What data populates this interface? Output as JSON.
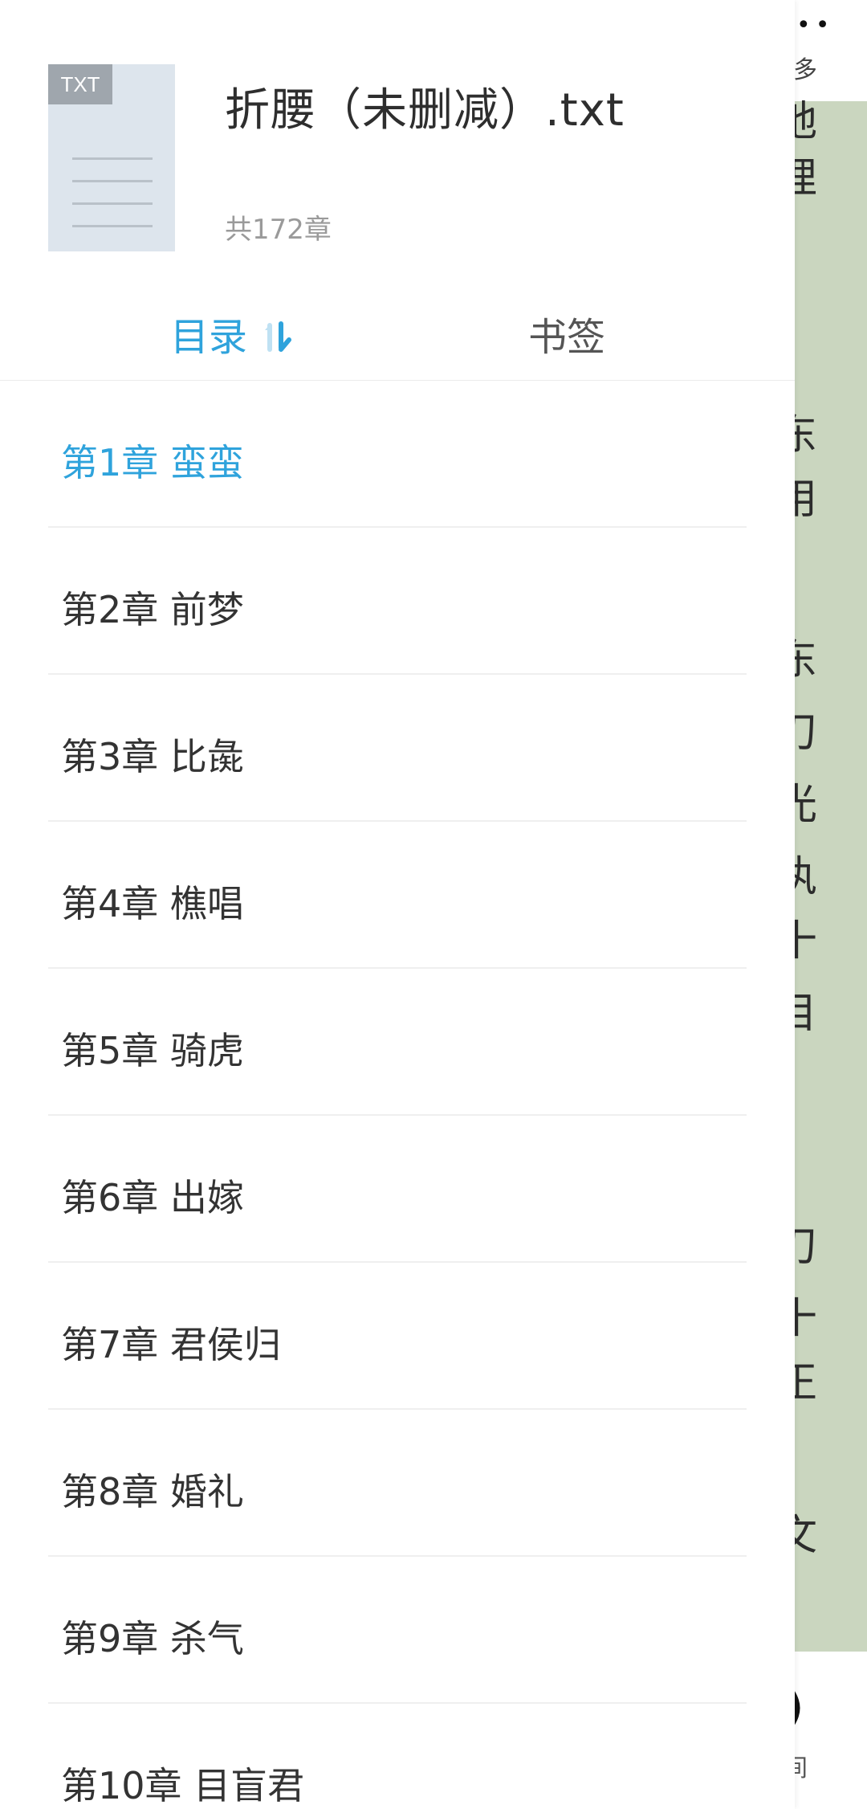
{
  "book": {
    "cover_badge": "TXT",
    "title": "折腰（未删减）.txt",
    "chapter_count": "共172章"
  },
  "tabs": {
    "catalog_label": "目录",
    "bookmark_label": "书签",
    "active": "catalog",
    "sort_icon": "sort-order-icon"
  },
  "chapters": [
    {
      "label": "第1章 蛮蛮",
      "current": true
    },
    {
      "label": "第2章 前梦"
    },
    {
      "label": "第3章 比彘"
    },
    {
      "label": "第4章 樵唱"
    },
    {
      "label": "第5章 骑虎"
    },
    {
      "label": "第6章 出嫁"
    },
    {
      "label": "第7章 君侯归"
    },
    {
      "label": "第8章 婚礼"
    },
    {
      "label": "第9章 杀气"
    },
    {
      "label": "第10章 目盲君"
    }
  ],
  "colors": {
    "accent": "#2fa3dc",
    "reader_background": "#cad6bf",
    "cover": "#dde5ed",
    "badge": "#9fa6ad"
  }
}
